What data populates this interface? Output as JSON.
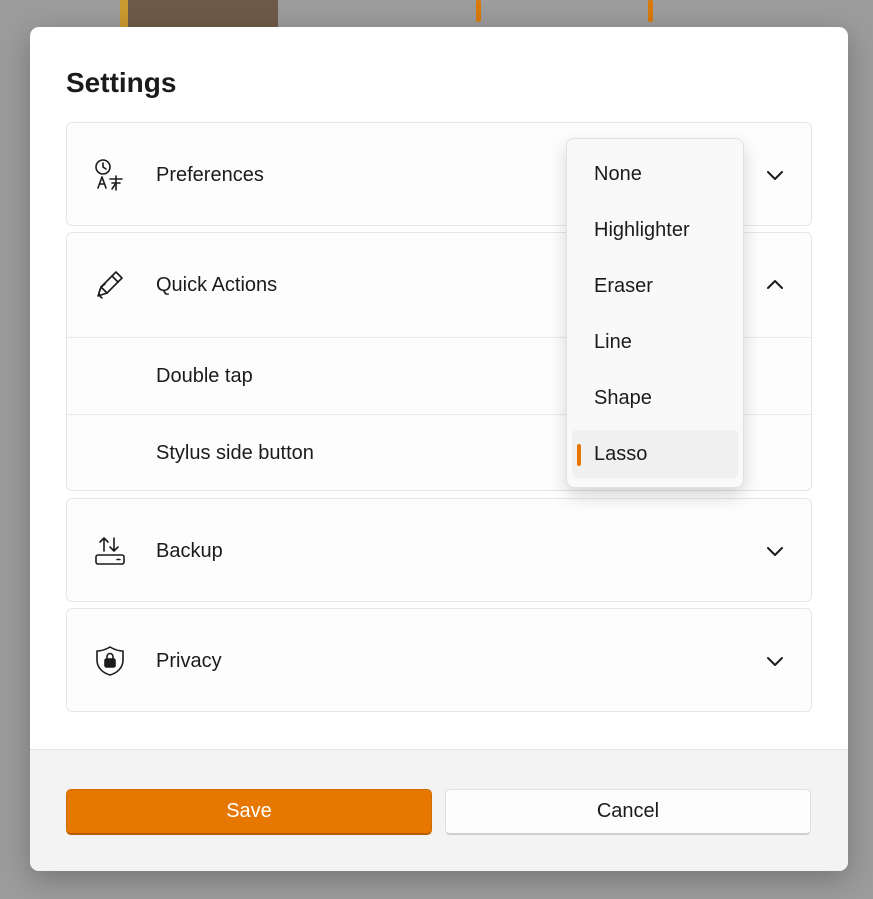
{
  "dialog": {
    "title": "Settings"
  },
  "sections": {
    "preferences": {
      "label": "Preferences",
      "icon": "time-language-icon",
      "expanded": false
    },
    "quick_actions": {
      "label": "Quick Actions",
      "icon": "stylus-icon",
      "expanded": true,
      "items": [
        {
          "label": "Double tap"
        },
        {
          "label": "Stylus side button"
        }
      ]
    },
    "backup": {
      "label": "Backup",
      "icon": "backup-icon",
      "expanded": false
    },
    "privacy": {
      "label": "Privacy",
      "icon": "shield-lock-icon",
      "expanded": false
    }
  },
  "dropdown": {
    "options": [
      "None",
      "Highlighter",
      "Eraser",
      "Line",
      "Shape",
      "Lasso"
    ],
    "selected": "Lasso"
  },
  "footer": {
    "save_label": "Save",
    "cancel_label": "Cancel"
  },
  "colors": {
    "accent": "#e67700",
    "dialog_bg": "#ffffff",
    "footer_bg": "#f3f3f3",
    "overlay": "#9c9c9c"
  }
}
